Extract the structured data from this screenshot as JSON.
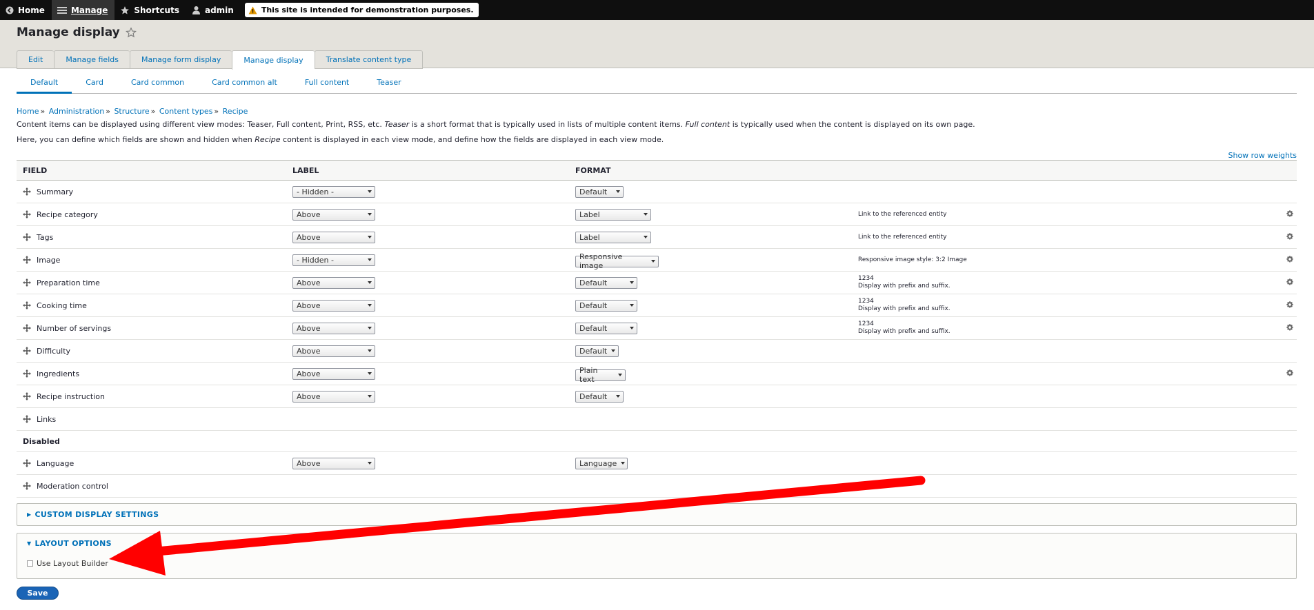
{
  "toolbar": {
    "home": "Home",
    "manage": "Manage",
    "shortcuts": "Shortcuts",
    "user": "admin",
    "demo_notice": "This site is intended for demonstration purposes."
  },
  "header": {
    "title": "Manage display",
    "tabs": [
      "Edit",
      "Manage fields",
      "Manage form display",
      "Manage display",
      "Translate content type"
    ]
  },
  "subtabs": [
    "Default",
    "Card",
    "Card common",
    "Card common alt",
    "Full content",
    "Teaser"
  ],
  "breadcrumb": [
    "Home",
    "Administration",
    "Structure",
    "Content types",
    "Recipe"
  ],
  "description": {
    "line1_a": "Content items can be displayed using different view modes: Teaser, Full content, Print, RSS, etc. ",
    "line1_b": "Teaser",
    "line1_c": " is a short format that is typically used in lists of multiple content items. ",
    "line1_d": "Full content",
    "line1_e": " is typically used when the content is displayed on its own page.",
    "line2_a": "Here, you can define which fields are shown and hidden when ",
    "line2_b": "Recipe",
    "line2_c": " content is displayed in each view mode, and define how the fields are displayed in each view mode."
  },
  "show_row_weights": "Show row weights",
  "table": {
    "headers": [
      "FIELD",
      "LABEL",
      "FORMAT"
    ],
    "rows": [
      {
        "field": "Summary",
        "label": "- Hidden -",
        "format": "Default",
        "summary": "",
        "summary2": ""
      },
      {
        "field": "Recipe category",
        "label": "Above",
        "format": "Label",
        "summary": "Link to the referenced entity",
        "summary2": ""
      },
      {
        "field": "Tags",
        "label": "Above",
        "format": "Label",
        "summary": "Link to the referenced entity",
        "summary2": ""
      },
      {
        "field": "Image",
        "label": "- Hidden -",
        "format": "Responsive image",
        "summary": "Responsive image style: 3:2 Image",
        "summary2": ""
      },
      {
        "field": "Preparation time",
        "label": "Above",
        "format": "Default",
        "summary": "1234",
        "summary2": "Display with prefix and suffix."
      },
      {
        "field": "Cooking time",
        "label": "Above",
        "format": "Default",
        "summary": "1234",
        "summary2": "Display with prefix and suffix."
      },
      {
        "field": "Number of servings",
        "label": "Above",
        "format": "Default",
        "summary": "1234",
        "summary2": "Display with prefix and suffix."
      },
      {
        "field": "Difficulty",
        "label": "Above",
        "format": "Default",
        "summary": "",
        "summary2": ""
      },
      {
        "field": "Ingredients",
        "label": "Above",
        "format": "Plain text",
        "summary": "",
        "summary2": ""
      },
      {
        "field": "Recipe instruction",
        "label": "Above",
        "format": "Default",
        "summary": "",
        "summary2": ""
      },
      {
        "field": "Links",
        "label": "",
        "format": "",
        "summary": "",
        "summary2": ""
      }
    ],
    "disabled_label": "Disabled",
    "disabled_rows": [
      {
        "field": "Language",
        "label": "Above",
        "format": "Language"
      },
      {
        "field": "Moderation control",
        "label": "",
        "format": ""
      }
    ]
  },
  "custom_display_settings": "CUSTOM DISPLAY SETTINGS",
  "layout_options": {
    "title": "LAYOUT OPTIONS",
    "checkbox_label": "Use Layout Builder"
  },
  "save_label": "Save",
  "annotation_color": "#ff0000"
}
